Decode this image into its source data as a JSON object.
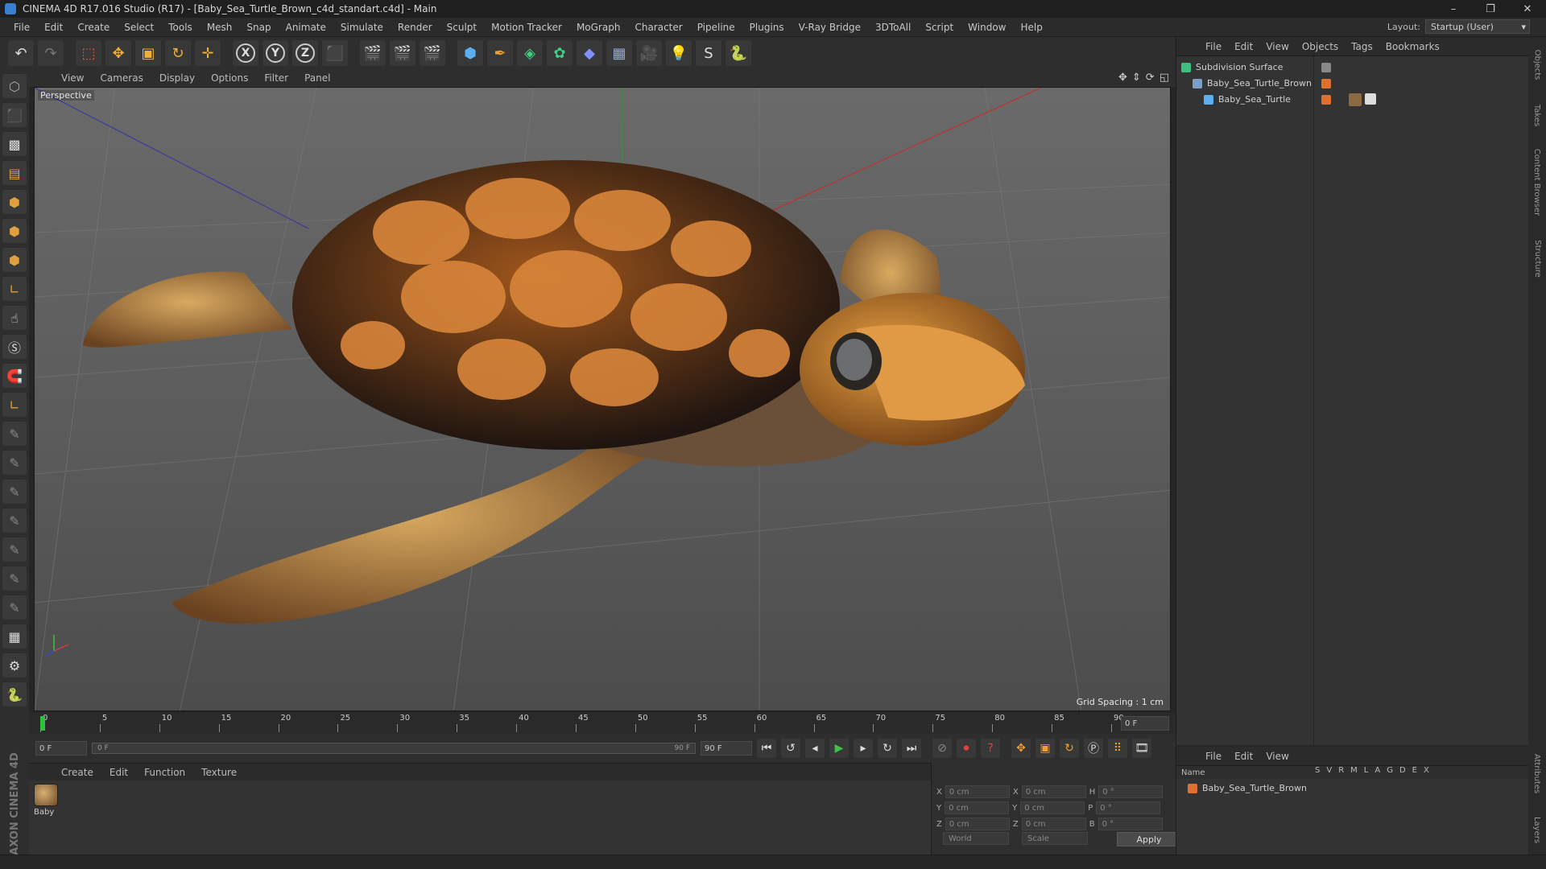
{
  "window": {
    "title": "CINEMA 4D R17.016 Studio (R17) - [Baby_Sea_Turtle_Brown_c4d_standart.c4d] - Main",
    "controls": [
      "–",
      "❐",
      "✕"
    ]
  },
  "menubar": {
    "items": [
      "File",
      "Edit",
      "Create",
      "Select",
      "Tools",
      "Mesh",
      "Snap",
      "Animate",
      "Simulate",
      "Render",
      "Sculpt",
      "Motion Tracker",
      "MoGraph",
      "Character",
      "Pipeline",
      "Plugins",
      "V-Ray Bridge",
      "3DToAll",
      "Script",
      "Window",
      "Help"
    ],
    "layout_label": "Layout:",
    "layout_value": "Startup (User)"
  },
  "toolbar": {
    "axis_x": "X",
    "axis_y": "Y",
    "axis_z": "Z"
  },
  "viewport": {
    "menu": [
      "View",
      "Cameras",
      "Display",
      "Options",
      "Filter",
      "Panel"
    ],
    "label": "Perspective",
    "grid_spacing": "Grid Spacing : 1 cm"
  },
  "timeline": {
    "ticks": [
      "0",
      "5",
      "10",
      "15",
      "20",
      "25",
      "30",
      "35",
      "40",
      "45",
      "50",
      "55",
      "60",
      "65",
      "70",
      "75",
      "80",
      "85",
      "90"
    ],
    "current_frame": "0 F",
    "start": "0 F",
    "range_start": "0 F",
    "range_end": "90 F",
    "end": "90 F"
  },
  "material_manager": {
    "menu": [
      "Create",
      "Edit",
      "Function",
      "Texture"
    ],
    "material_name": "Baby"
  },
  "coordinates": {
    "rows": [
      {
        "a": "X",
        "av": "0 cm",
        "b": "X",
        "bv": "0 cm",
        "c": "H",
        "cv": "0 °"
      },
      {
        "a": "Y",
        "av": "0 cm",
        "b": "Y",
        "bv": "0 cm",
        "c": "P",
        "cv": "0 °"
      },
      {
        "a": "Z",
        "av": "0 cm",
        "b": "Z",
        "bv": "0 cm",
        "c": "B",
        "cv": "0 °"
      }
    ],
    "mode": "World",
    "transform": "Scale",
    "apply": "Apply"
  },
  "object_manager": {
    "menu": [
      "File",
      "Edit",
      "View",
      "Objects",
      "Tags",
      "Bookmarks"
    ],
    "objects": [
      "Subdivision Surface",
      "Baby_Sea_Turtle_Brown",
      "Baby_Sea_Turtle"
    ]
  },
  "layer_manager": {
    "menu": [
      "File",
      "Edit",
      "View"
    ],
    "name_header": "Name",
    "columns": [
      "S",
      "V",
      "R",
      "M",
      "L",
      "A",
      "G",
      "D",
      "E",
      "X"
    ],
    "layer": "Baby_Sea_Turtle_Brown"
  },
  "side_tabs": [
    "Objects",
    "Takes",
    "Content Browser",
    "Structure",
    "Attributes",
    "Layers"
  ],
  "brand": "MAXON CINEMA 4D"
}
